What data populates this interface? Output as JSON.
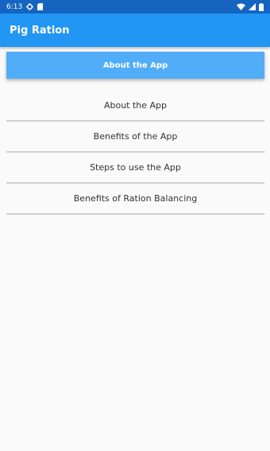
{
  "status_bar": {
    "time": "6:13",
    "left_icons": [
      "gear-icon",
      "sim-card-icon"
    ],
    "right_icons": [
      "wifi-icon",
      "signal-icon",
      "battery-icon"
    ]
  },
  "app_bar": {
    "title": "Pig Ration",
    "color": "#2196f3"
  },
  "main": {
    "header_button_label": "About the App",
    "button_color": "#52adf9",
    "menu_items": [
      {
        "label": "About the App"
      },
      {
        "label": "Benefits of the App"
      },
      {
        "label": "Steps to use the App"
      },
      {
        "label": "Benefits of Ration Balancing"
      }
    ]
  }
}
